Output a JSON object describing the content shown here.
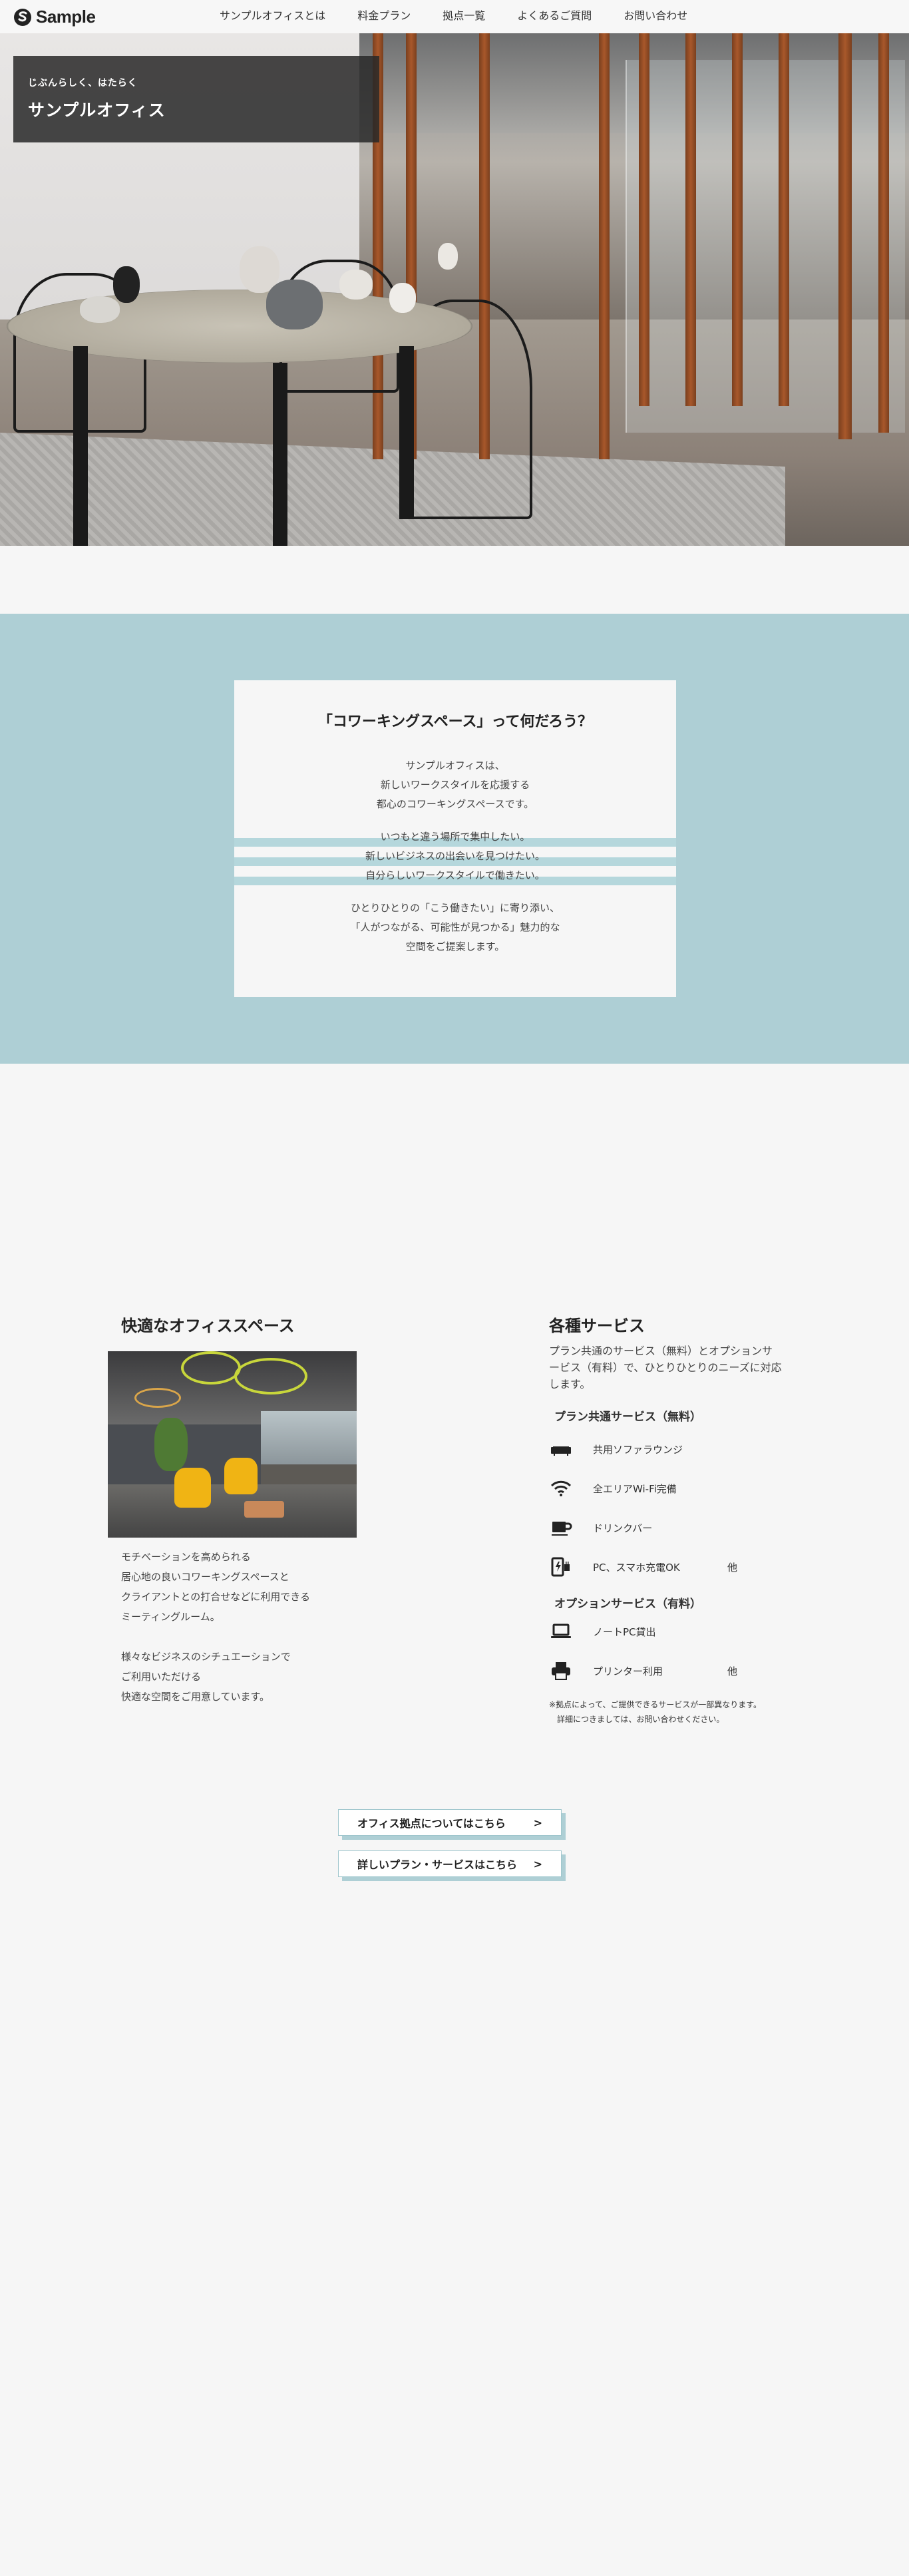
{
  "header": {
    "logo_text": "Sample",
    "nav": [
      "サンプルオフィスとは",
      "料金プラン",
      "拠点一覧",
      "よくあるご質問",
      "お問い合わせ"
    ]
  },
  "hero": {
    "kicker": "じぶんらしく、はたらく",
    "title": "サンプルオフィス"
  },
  "about": {
    "heading": "「コワーキングスペース」って何だろう？",
    "intro": [
      "サンプルオフィスは、",
      "新しいワークスタイルを応援する",
      "都心のコワーキングスペースです。"
    ],
    "highlights": [
      "いつもと違う場所で集中したい。",
      "新しいビジネスの出会いを見つけたい。",
      "自分らしいワークスタイルで働きたい。"
    ],
    "closing": [
      "ひとりひとりの「こう働きたい」に寄り添い、",
      "「人がつながる、可能性が見つかる」魅力的な",
      "空間をご提案します。"
    ]
  },
  "office": {
    "title": "快適なオフィススペース",
    "text": [
      "モチベーションを高められる",
      "居心地の良いコワーキングスペースと",
      "クライアントとの打合せなどに利用できる",
      "ミーティングルーム。",
      "",
      "様々なビジネスのシチュエーションで",
      "ご利用いただける",
      "快適な空間をご用意しています。"
    ]
  },
  "services": {
    "title": "各種サービス",
    "description": "プラン共通のサービス（無料）とオプションサービス（有料）で、ひとりひとりのニーズに対応します。",
    "common_heading": "プラン共通サービス（無料）",
    "common_items": [
      {
        "icon": "sofa-icon",
        "label": "共用ソファラウンジ"
      },
      {
        "icon": "wifi-icon",
        "label": "全エリアWi-Fi完備"
      },
      {
        "icon": "coffee-cup-icon",
        "label": "ドリンクバー"
      },
      {
        "icon": "charging-icon",
        "label": "PC、スマホ充電OK"
      }
    ],
    "common_other": "他",
    "option_heading": "オプションサービス（有料）",
    "option_items": [
      {
        "icon": "laptop-icon",
        "label": "ノートPC貸出"
      },
      {
        "icon": "printer-icon",
        "label": "プリンター利用"
      }
    ],
    "option_other": "他",
    "note": [
      "※拠点によって、ご提供できるサービスが一部異なります。",
      "　詳細につきましては、お問い合わせください。"
    ]
  },
  "links": [
    {
      "label": "オフィス拠点についてはこちら",
      "arrow": ">"
    },
    {
      "label": "詳しいプラン・サービスはこちら",
      "arrow": ">"
    }
  ],
  "colors": {
    "accent": "#aecfd5",
    "background": "#f6f6f6",
    "hero_label": "#333333"
  }
}
